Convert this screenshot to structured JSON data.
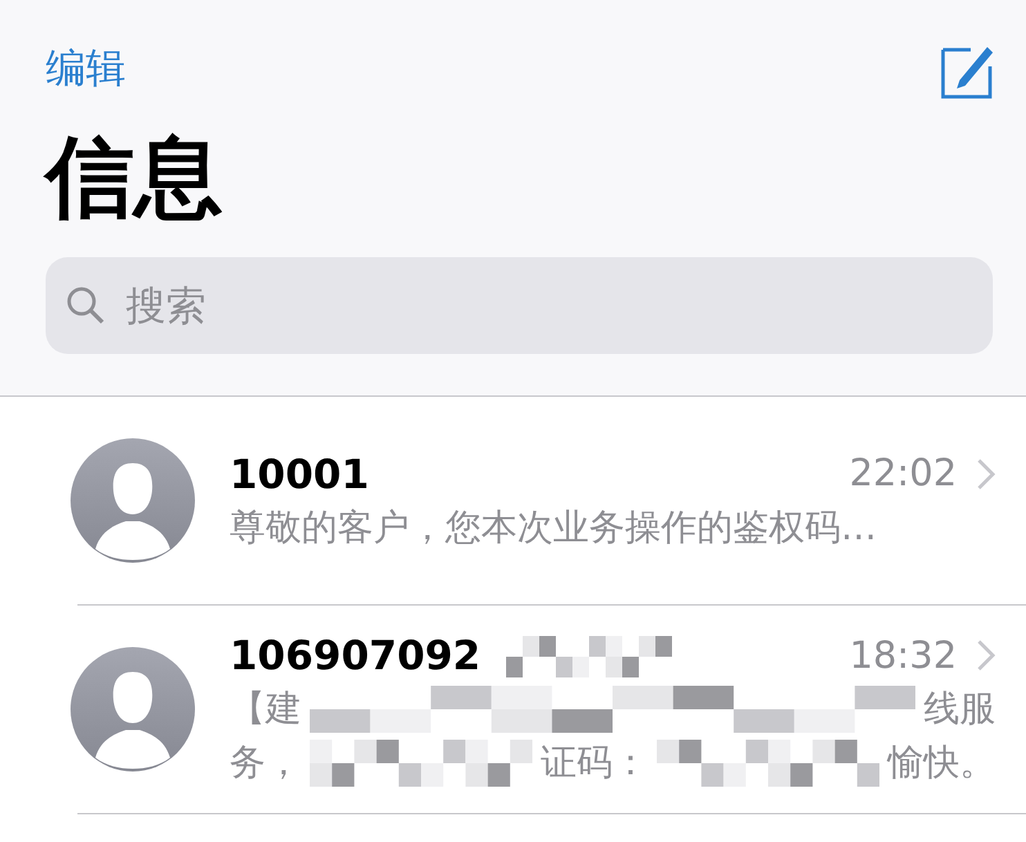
{
  "nav": {
    "edit": "编辑"
  },
  "title": "信息",
  "search": {
    "placeholder": "搜索"
  },
  "conversations": [
    {
      "name": "10001",
      "time": "22:02",
      "preview_lines": [
        [
          "尊敬的客户，您本次业务操作的鉴权码…"
        ]
      ],
      "censored": false
    },
    {
      "name": "106907092",
      "time": "18:32",
      "preview_lines": [
        [
          "【建",
          "线服"
        ],
        [
          "务，",
          "证码：",
          "愉快。"
        ]
      ],
      "censored": true
    }
  ]
}
